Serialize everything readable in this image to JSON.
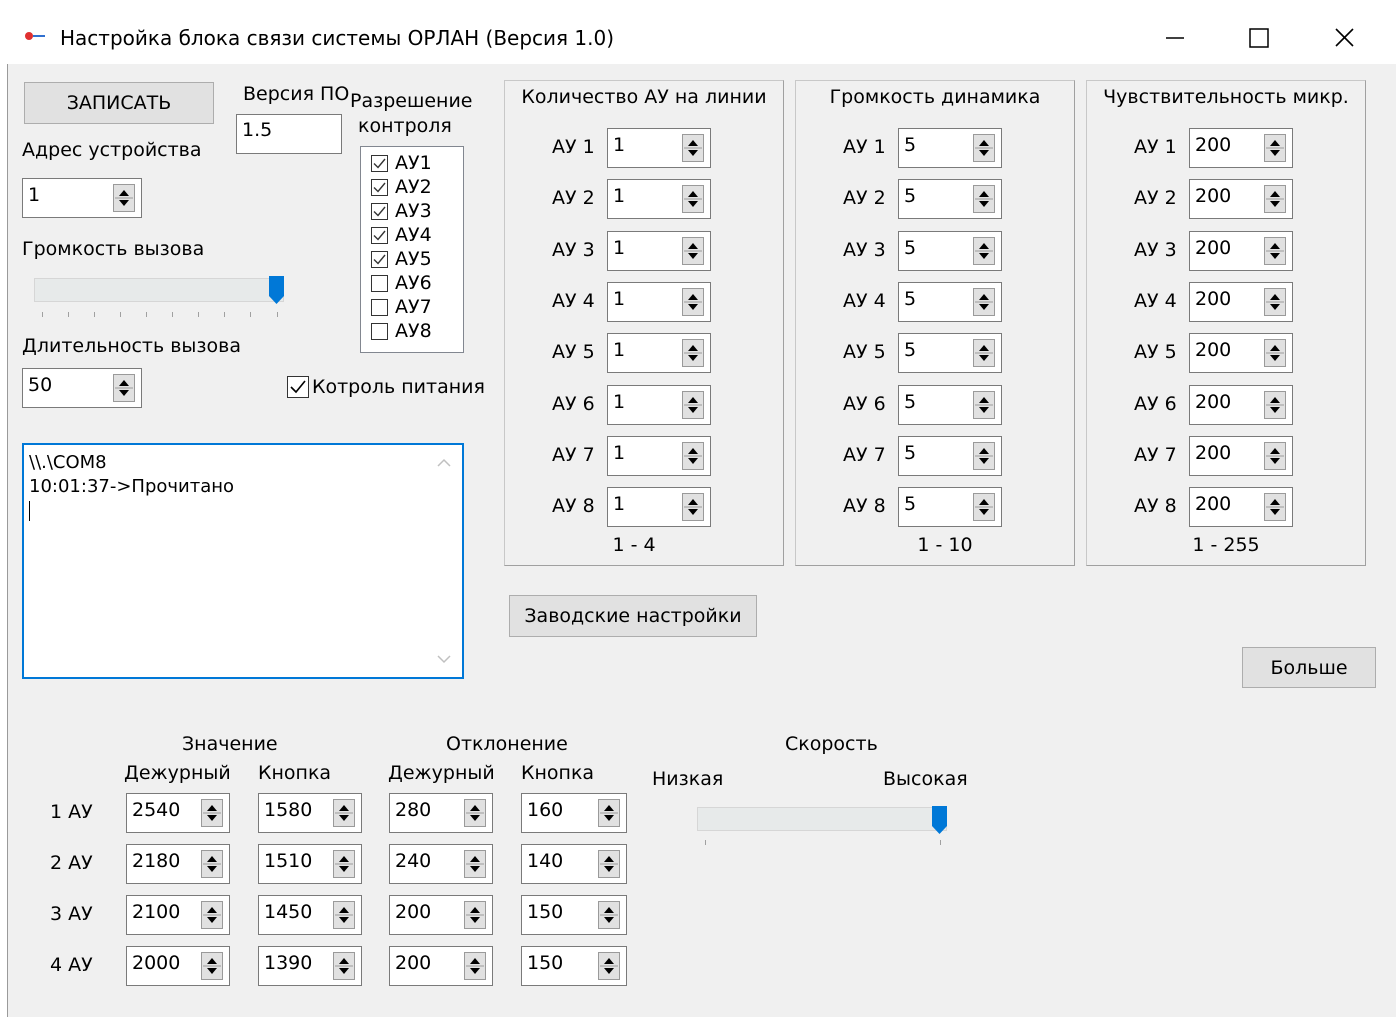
{
  "window": {
    "title": "Настройка блока связи системы ОРЛАН (Версия 1.0)",
    "minimize_glyph": "—",
    "maximize_glyph": "☐",
    "close_glyph": "✕"
  },
  "left_panel": {
    "write_button": "ЗАПИСАТЬ",
    "firmware_label": "Версия ПО",
    "firmware_value": "1.5",
    "device_address_label": "Адрес устройства",
    "device_address_value": "1",
    "call_volume_label": "Громкость вызова",
    "call_volume_level": 1.0,
    "call_duration_label": "Длительность вызова",
    "call_duration_value": "50",
    "control_label_1": "Разрешение",
    "control_label_2": "контроля",
    "control_items": [
      {
        "label": "АУ1",
        "checked": true
      },
      {
        "label": "АУ2",
        "checked": true
      },
      {
        "label": "АУ3",
        "checked": true
      },
      {
        "label": "АУ4",
        "checked": true
      },
      {
        "label": "АУ5",
        "checked": true
      },
      {
        "label": "АУ6",
        "checked": false
      },
      {
        "label": "АУ7",
        "checked": false
      },
      {
        "label": "АУ8",
        "checked": false
      }
    ],
    "power_control_label": "Котроль питания",
    "power_control_checked": true
  },
  "log": {
    "lines": [
      "\\\\.\\COM8",
      "10:01:37->Прочитано"
    ]
  },
  "groups": {
    "count": {
      "title": "Количество АУ на линии",
      "range": "1 - 4",
      "rows": [
        {
          "label": "АУ 1",
          "value": "1"
        },
        {
          "label": "АУ 2",
          "value": "1"
        },
        {
          "label": "АУ 3",
          "value": "1"
        },
        {
          "label": "АУ 4",
          "value": "1"
        },
        {
          "label": "АУ 5",
          "value": "1"
        },
        {
          "label": "АУ 6",
          "value": "1"
        },
        {
          "label": "АУ 7",
          "value": "1"
        },
        {
          "label": "АУ 8",
          "value": "1"
        }
      ]
    },
    "volume": {
      "title": "Громкость динамика",
      "range": "1 - 10",
      "rows": [
        {
          "label": "АУ 1",
          "value": "5"
        },
        {
          "label": "АУ 2",
          "value": "5"
        },
        {
          "label": "АУ 3",
          "value": "5"
        },
        {
          "label": "АУ 4",
          "value": "5"
        },
        {
          "label": "АУ 5",
          "value": "5"
        },
        {
          "label": "АУ 6",
          "value": "5"
        },
        {
          "label": "АУ 7",
          "value": "5"
        },
        {
          "label": "АУ 8",
          "value": "5"
        }
      ]
    },
    "sensitivity": {
      "title": "Чувствительность микр.",
      "range": "1 - 255",
      "rows": [
        {
          "label": "АУ 1",
          "value": "200"
        },
        {
          "label": "АУ 2",
          "value": "200"
        },
        {
          "label": "АУ 3",
          "value": "200"
        },
        {
          "label": "АУ 4",
          "value": "200"
        },
        {
          "label": "АУ 5",
          "value": "200"
        },
        {
          "label": "АУ 6",
          "value": "200"
        },
        {
          "label": "АУ 7",
          "value": "200"
        },
        {
          "label": "АУ 8",
          "value": "200"
        }
      ]
    }
  },
  "factory_button": "Заводские настройки",
  "more_button": "Больше",
  "bottom": {
    "value_header": "Значение",
    "deviation_header": "Отклонение",
    "duty_header": "Дежурный",
    "button_header": "Кнопка",
    "rows": [
      {
        "label": "1 АУ",
        "val_duty": "2540",
        "val_button": "1580",
        "dev_duty": "280",
        "dev_button": "160"
      },
      {
        "label": "2 АУ",
        "val_duty": "2180",
        "val_button": "1510",
        "dev_duty": "240",
        "dev_button": "140"
      },
      {
        "label": "3 АУ",
        "val_duty": "2100",
        "val_button": "1450",
        "dev_duty": "200",
        "dev_button": "150"
      },
      {
        "label": "4 АУ",
        "val_duty": "2000",
        "val_button": "1390",
        "dev_duty": "200",
        "dev_button": "150"
      }
    ],
    "speed_label": "Скорость",
    "speed_low": "Низкая",
    "speed_high": "Высокая",
    "speed_level": 1.0
  }
}
